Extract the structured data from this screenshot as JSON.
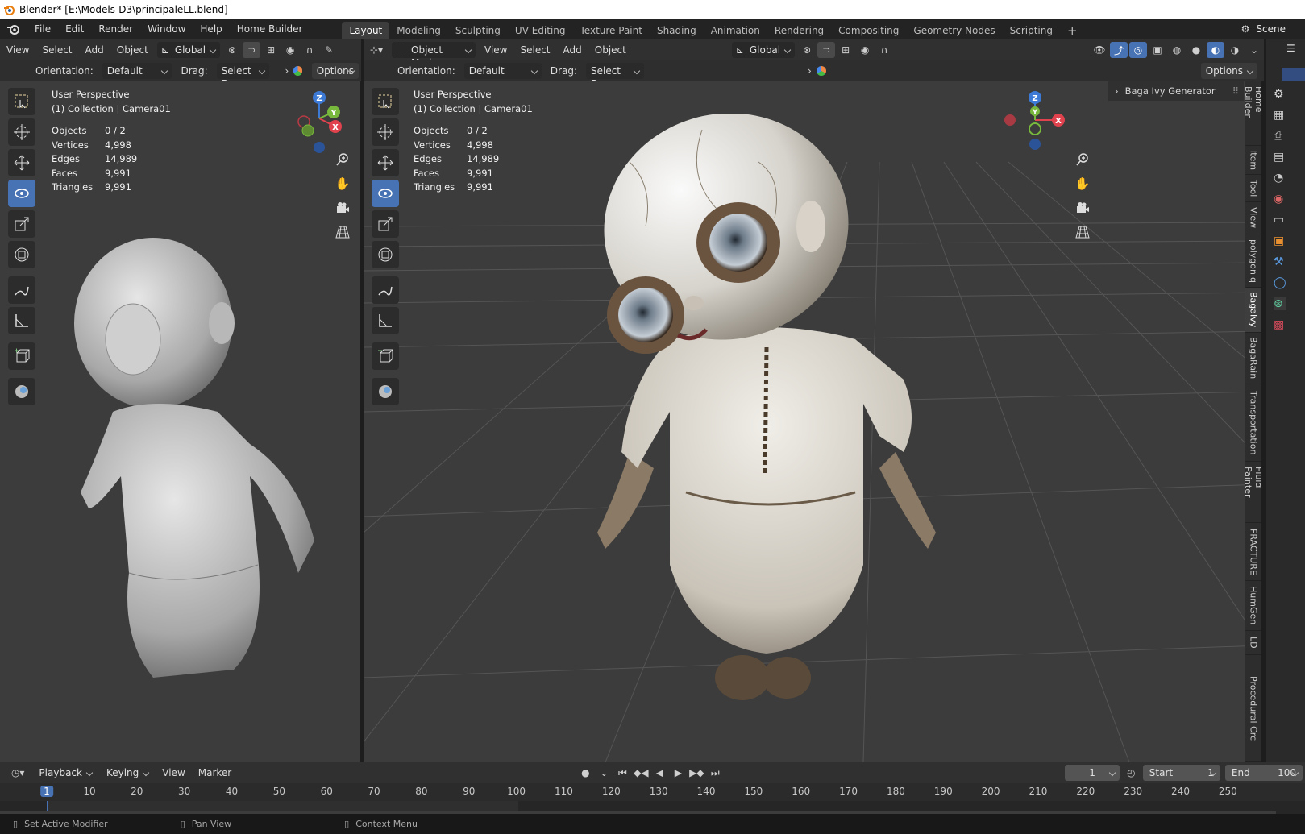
{
  "window": {
    "title": "Blender* [E:\\Models-D3\\principaleLL.blend]"
  },
  "menu": {
    "file": "File",
    "edit": "Edit",
    "render": "Render",
    "window": "Window",
    "help": "Help",
    "home_builder": "Home Builder"
  },
  "workspaces": [
    "Layout",
    "Modeling",
    "Sculpting",
    "UV Editing",
    "Texture Paint",
    "Shading",
    "Animation",
    "Rendering",
    "Compositing",
    "Geometry Nodes",
    "Scripting"
  ],
  "scene": {
    "label": "Scene"
  },
  "left_viewport": {
    "header": {
      "view": "View",
      "select": "Select",
      "add": "Add",
      "object": "Object",
      "transform": "Global"
    },
    "tool_header": {
      "orientation_label": "Orientation:",
      "orientation_value": "Default",
      "drag_label": "Drag:",
      "drag_value": "Select Box",
      "options": "Options"
    },
    "perspective": "User Perspective",
    "collection": "(1) Collection | Camera01"
  },
  "right_viewport": {
    "header": {
      "mode": "Object Mode",
      "view": "View",
      "select": "Select",
      "add": "Add",
      "object": "Object",
      "transform": "Global"
    },
    "tool_header": {
      "orientation_label": "Orientation:",
      "orientation_value": "Default",
      "drag_label": "Drag:",
      "drag_value": "Select Box",
      "options": "Options"
    },
    "perspective": "User Perspective",
    "collection": "(1) Collection | Camera01",
    "panel": {
      "title": "Baga Ivy Generator"
    },
    "side_tabs": [
      "Home Builder",
      "Item",
      "Tool",
      "View",
      "polygoniq",
      "BagaIvy",
      "BagaRain",
      "Transportation",
      "Fluid Painter",
      "FRACTURE",
      "HumGen",
      "LD",
      "Procedural Crc"
    ]
  },
  "stats": {
    "objects_label": "Objects",
    "objects": "0 / 2",
    "vertices_label": "Vertices",
    "vertices": "4,998",
    "edges_label": "Edges",
    "edges": "14,989",
    "faces_label": "Faces",
    "faces": "9,991",
    "triangles_label": "Triangles",
    "triangles": "9,991"
  },
  "gizmo": {
    "x": "X",
    "y": "Y",
    "z": "Z"
  },
  "timeline": {
    "playback": "Playback",
    "keying": "Keying",
    "view": "View",
    "marker": "Marker",
    "current_frame": "1",
    "start_label": "Start",
    "start": "1",
    "end_label": "End",
    "end": "100",
    "ticks": [
      "1",
      "10",
      "20",
      "30",
      "40",
      "50",
      "60",
      "70",
      "80",
      "90",
      "100",
      "110",
      "120",
      "130",
      "140",
      "150",
      "160",
      "170",
      "180",
      "190",
      "200",
      "210",
      "220",
      "230",
      "240",
      "250"
    ]
  },
  "status": {
    "left": "Set Active Modifier",
    "middle": "Pan View",
    "right": "Context Menu"
  },
  "colors": {
    "accent": "#4772b3",
    "viewport_bg": "#3c3c3c",
    "header_bg": "#303030",
    "axis_x": "#e0424e",
    "axis_y": "#78b83c",
    "axis_z": "#3c7ad6"
  }
}
